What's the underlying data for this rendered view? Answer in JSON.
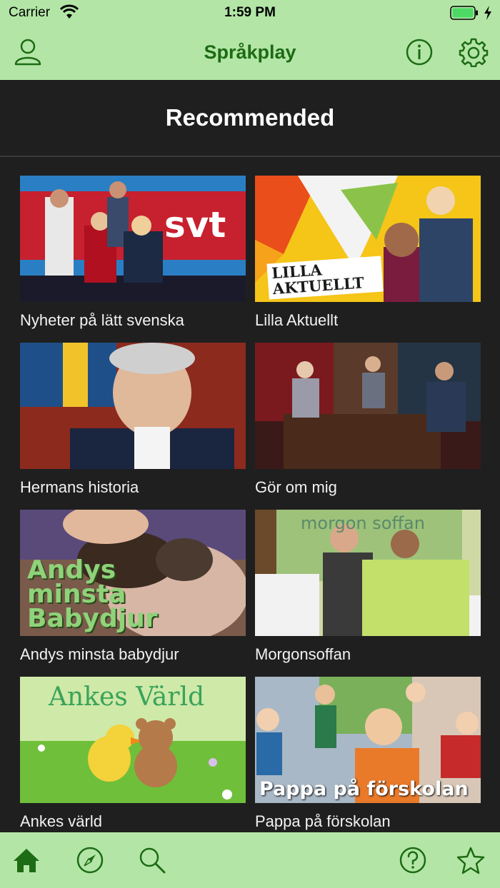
{
  "status_bar": {
    "carrier": "Carrier",
    "time": "1:59 PM",
    "battery_color": "#4cd964"
  },
  "nav": {
    "title": "Språkplay",
    "left_icon": "person-icon",
    "right_icons": [
      "info-icon",
      "gear-icon"
    ],
    "tint": "#1d6b14"
  },
  "section": {
    "heading": "Recommended"
  },
  "programs": [
    {
      "title": "Nyheter på lätt svenska",
      "thumb_text": "svt"
    },
    {
      "title": "Lilla Aktuellt",
      "thumb_text": "LILLA AKTUELLT"
    },
    {
      "title": "Hermans historia",
      "thumb_text": ""
    },
    {
      "title": "Gör om mig",
      "thumb_text": ""
    },
    {
      "title": "Andys minsta babydjur",
      "thumb_text": "Andys minsta Babydjur"
    },
    {
      "title": "Morgonsoffan",
      "thumb_text": "morgon soffan"
    },
    {
      "title": "Ankes värld",
      "thumb_text": "Ankes Värld"
    },
    {
      "title": "Pappa på förskolan",
      "thumb_text": "Pappa på förskolan"
    }
  ],
  "tab_bar": {
    "tabs": [
      "home-icon",
      "compass-icon",
      "search-icon",
      "help-icon",
      "star-icon"
    ],
    "active": "home-icon"
  }
}
